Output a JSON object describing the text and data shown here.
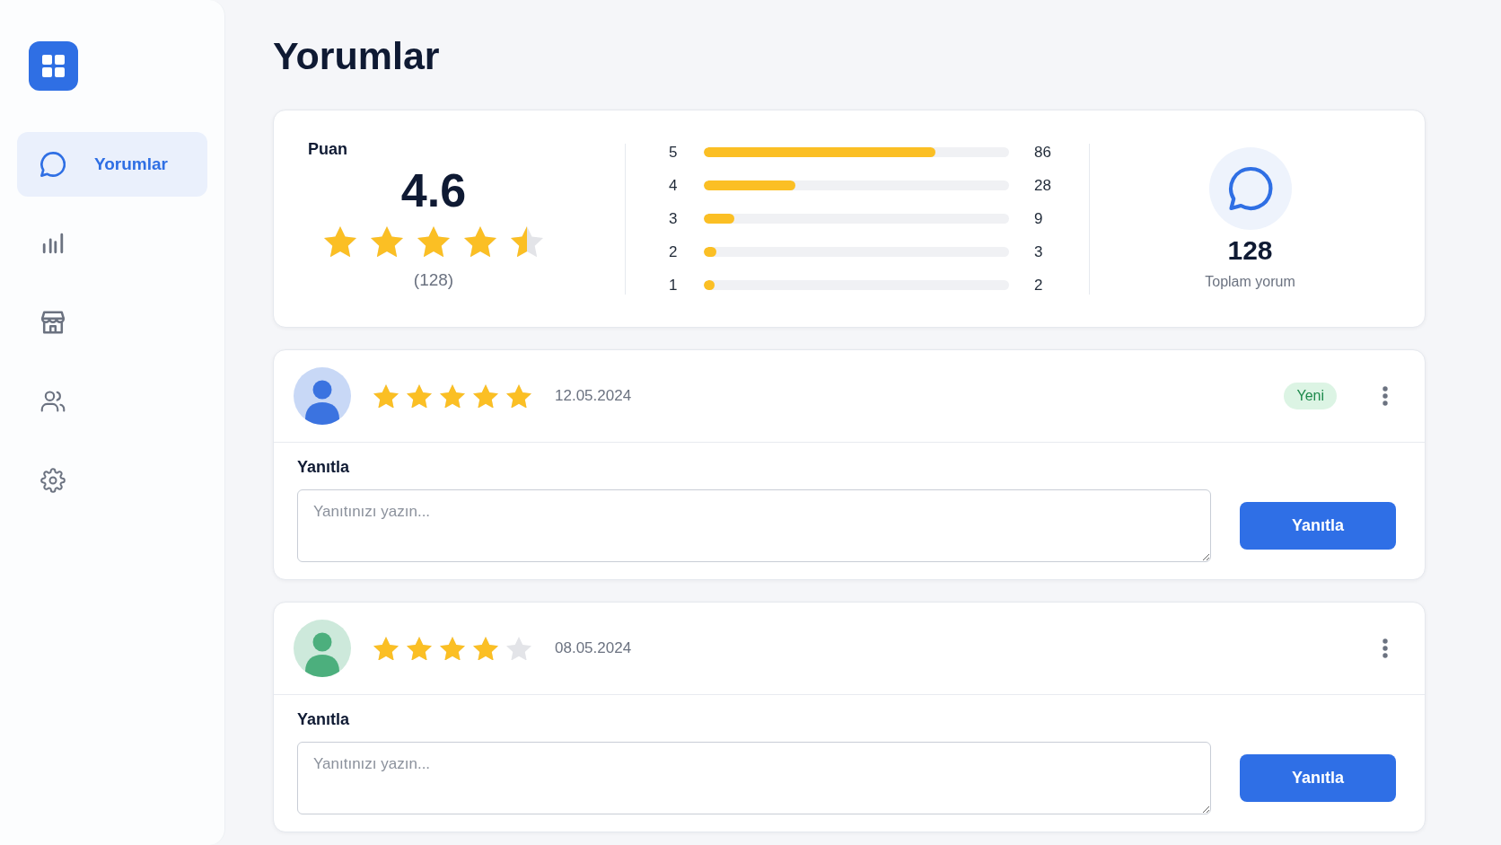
{
  "sidebar": {
    "items": [
      {
        "label": "Yorumlar",
        "selected": true
      },
      {
        "selected": false
      },
      {
        "selected": false
      },
      {
        "selected": false
      },
      {
        "selected": false
      }
    ]
  },
  "page_title": "Yorumlar",
  "summary": {
    "rating_label": "Puan",
    "rating": "4.6",
    "stars": 4.5,
    "rating_count": "(128)",
    "distribution": [
      {
        "label": "5",
        "level": 0.76,
        "count": "86"
      },
      {
        "label": "4",
        "level": 0.3,
        "count": "28"
      },
      {
        "label": "3",
        "level": 0.1,
        "count": "9"
      },
      {
        "label": "2",
        "level": 0.04,
        "count": "3"
      },
      {
        "label": "1",
        "level": 0.035,
        "count": "2"
      }
    ],
    "total": "128",
    "total_label": "Toplam yorum"
  },
  "reviews": [
    {
      "color": "#3b73e0",
      "stars": 5,
      "date": "12.05.2024",
      "badge": "Yeni",
      "reply_label": "Yanıtla",
      "placeholder": "Yanıtınızı yazın...",
      "button": "Yanıtla"
    },
    {
      "color": "#4caf7d",
      "stars": 4,
      "date": "08.05.2024",
      "reply_label": "Yanıtla",
      "placeholder": "Yanıtınızı yazın...",
      "button": "Yanıtla"
    }
  ]
}
